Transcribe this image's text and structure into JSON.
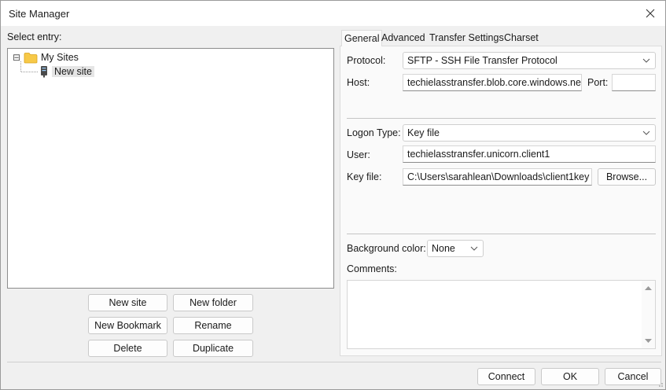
{
  "window": {
    "title": "Site Manager"
  },
  "left": {
    "select_label": "Select entry:",
    "tree": {
      "root": {
        "label": "My Sites",
        "expander": "⊟",
        "icon": "folder-icon"
      },
      "child": {
        "label": "New site",
        "icon": "server-icon",
        "selected": true
      }
    },
    "buttons": {
      "new_site": "New site",
      "new_folder": "New folder",
      "new_bookmark": "New Bookmark",
      "rename": "Rename",
      "delete": "Delete",
      "duplicate": "Duplicate"
    }
  },
  "tabs": [
    {
      "label": "General",
      "active": true
    },
    {
      "label": "Advanced",
      "active": false
    },
    {
      "label": "Transfer Settings",
      "active": false
    },
    {
      "label": "Charset",
      "active": false
    }
  ],
  "general": {
    "protocol_label": "Protocol:",
    "protocol_value": "SFTP - SSH File Transfer Protocol",
    "host_label": "Host:",
    "host_value": "techielasstransfer.blob.core.windows.net",
    "port_label": "Port:",
    "port_value": "",
    "logon_type_label": "Logon Type:",
    "logon_type_value": "Key file",
    "user_label": "User:",
    "user_value": "techielasstransfer.unicorn.client1",
    "keyfile_label": "Key file:",
    "keyfile_value": "C:\\Users\\sarahlean\\Downloads\\client1key",
    "browse_label": "Browse...",
    "bgcolor_label": "Background color:",
    "bgcolor_value": "None",
    "comments_label": "Comments:",
    "comments_value": ""
  },
  "footer": {
    "connect": "Connect",
    "ok": "OK",
    "cancel": "Cancel"
  },
  "colors": {
    "folder": "#f7c948",
    "selected_bg": "#e5e5e5"
  }
}
